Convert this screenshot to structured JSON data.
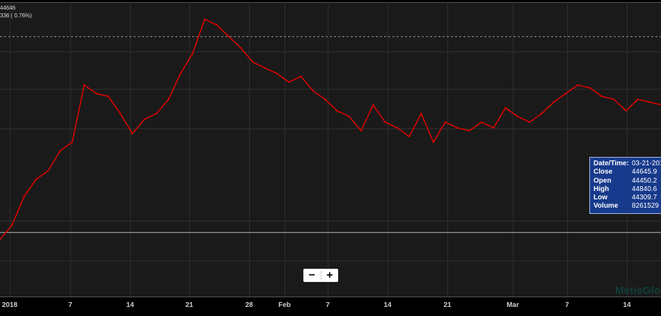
{
  "last_info": {
    "price": "44646",
    "change": "336 ( 0.76%)"
  },
  "chart_data": {
    "type": "line",
    "title": "",
    "xlabel": "",
    "ylabel": "",
    "line_color": "#e00000",
    "grid": true,
    "background": "#1a1a1a",
    "y_reference": 41220,
    "y_last_price": 44646,
    "ylim": [
      40100,
      45250
    ],
    "x_tick_labels": [
      "2018",
      "7",
      "14",
      "21",
      "28",
      "Feb",
      "7",
      "14",
      "21",
      "Mar",
      "7",
      "14"
    ],
    "x": [
      "2017-12-29",
      "2018-01-01",
      "2018-01-02",
      "2018-01-03",
      "2018-01-04",
      "2018-01-05",
      "2018-01-08",
      "2018-01-09",
      "2018-01-10",
      "2018-01-11",
      "2018-01-12",
      "2018-01-15",
      "2018-01-16",
      "2018-01-17",
      "2018-01-18",
      "2018-01-19",
      "2018-01-22",
      "2018-01-23",
      "2018-01-24",
      "2018-01-25",
      "2018-01-26",
      "2018-01-29",
      "2018-01-30",
      "2018-01-31",
      "2018-02-01",
      "2018-02-02",
      "2018-02-05",
      "2018-02-06",
      "2018-02-07",
      "2018-02-08",
      "2018-02-09",
      "2018-02-12",
      "2018-02-13",
      "2018-02-14",
      "2018-02-15",
      "2018-02-16",
      "2018-02-19",
      "2018-02-20",
      "2018-02-21",
      "2018-02-22",
      "2018-02-23",
      "2018-02-26",
      "2018-02-27",
      "2018-02-28",
      "2018-03-01",
      "2018-03-02",
      "2018-03-05",
      "2018-03-06",
      "2018-03-07",
      "2018-03-08",
      "2018-03-09",
      "2018-03-12",
      "2018-03-13",
      "2018-03-14",
      "2018-03-15",
      "2018-03-16"
    ],
    "values": [
      41100,
      41350,
      41850,
      42150,
      42300,
      42650,
      42800,
      43800,
      43650,
      43600,
      43300,
      42950,
      43200,
      43300,
      43550,
      44000,
      44350,
      44950,
      44850,
      44650,
      44450,
      44200,
      44100,
      44000,
      43850,
      43950,
      43700,
      43550,
      43350,
      43250,
      43000,
      43450,
      43150,
      43050,
      42900,
      43300,
      42800,
      43150,
      43050,
      43000,
      43150,
      43050,
      43400,
      43250,
      43150,
      43300,
      43500,
      43650,
      43800,
      43750,
      43600,
      43550,
      43350,
      43550,
      43500,
      43450
    ],
    "tooltip": {
      "rows": [
        {
          "key": "Date/Time:",
          "value": "03-21-201"
        },
        {
          "key": "Close",
          "value": "44645.9"
        },
        {
          "key": "Open",
          "value": "44450.2"
        },
        {
          "key": "High",
          "value": "44840.6"
        },
        {
          "key": "Low",
          "value": "44309.7"
        },
        {
          "key": "Volume",
          "value": "8261529"
        }
      ]
    }
  },
  "zoom": {
    "minus": "−",
    "plus": "+"
  },
  "watermark": "MetisGlo"
}
